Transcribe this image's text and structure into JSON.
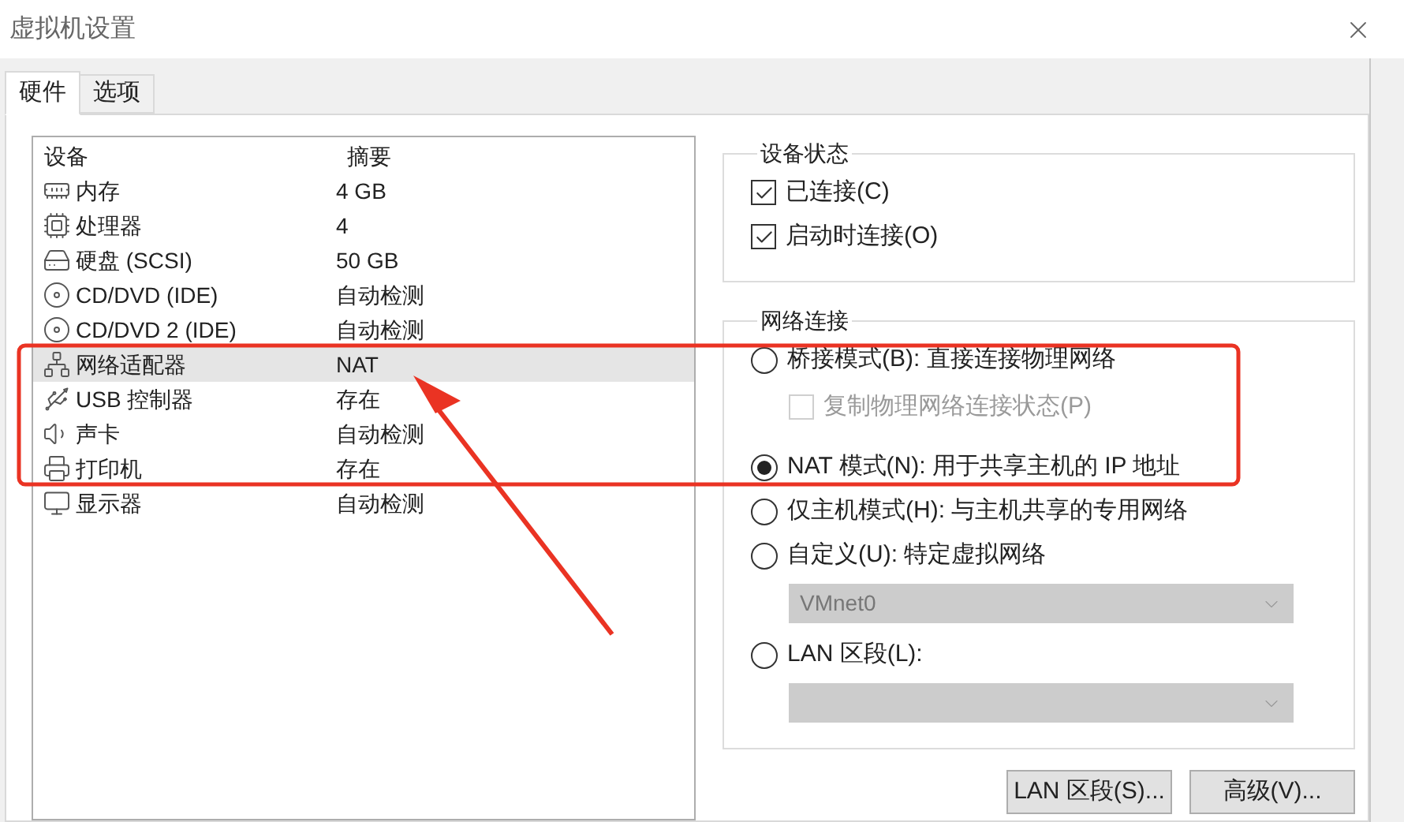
{
  "window": {
    "title": "虚拟机设置"
  },
  "tabs": [
    {
      "label": "硬件",
      "selected": true
    },
    {
      "label": "选项",
      "selected": false
    }
  ],
  "device_table": {
    "columns": [
      "设备",
      "摘要"
    ],
    "rows": [
      {
        "kind": "memory",
        "device": "内存",
        "summary": "4 GB",
        "selected": false
      },
      {
        "kind": "cpu",
        "device": "处理器",
        "summary": "4",
        "selected": false
      },
      {
        "kind": "disk",
        "device": "硬盘 (SCSI)",
        "summary": "50 GB",
        "selected": false
      },
      {
        "kind": "cd",
        "device": "CD/DVD (IDE)",
        "summary": "自动检测",
        "selected": false
      },
      {
        "kind": "cd",
        "device": "CD/DVD 2 (IDE)",
        "summary": "自动检测",
        "selected": false
      },
      {
        "kind": "network",
        "device": "网络适配器",
        "summary": "NAT",
        "selected": true
      },
      {
        "kind": "usb",
        "device": "USB 控制器",
        "summary": "存在",
        "selected": false
      },
      {
        "kind": "sound",
        "device": "声卡",
        "summary": "自动检测",
        "selected": false
      },
      {
        "kind": "printer",
        "device": "打印机",
        "summary": "存在",
        "selected": false
      },
      {
        "kind": "display",
        "device": "显示器",
        "summary": "自动检测",
        "selected": false
      }
    ]
  },
  "device_status": {
    "title": "设备状态",
    "options": [
      {
        "label": "已连接(C)",
        "checked": true
      },
      {
        "label": "启动时连接(O)",
        "checked": true
      }
    ]
  },
  "network": {
    "title": "网络连接",
    "options": [
      {
        "kind": "radio",
        "label": "桥接模式(B): 直接连接物理网络",
        "selected": false
      },
      {
        "kind": "checkbox",
        "label": "复制物理网络连接状态(P)",
        "checked": false,
        "disabled": true
      },
      {
        "kind": "radio",
        "label": "NAT 模式(N): 用于共享主机的 IP 地址",
        "selected": true
      },
      {
        "kind": "radio",
        "label": "仅主机模式(H): 与主机共享的专用网络",
        "selected": false
      },
      {
        "kind": "radio",
        "label": "自定义(U): 特定虚拟网络",
        "selected": false
      },
      {
        "kind": "dropdown",
        "value": "VMnet0",
        "disabled": true
      },
      {
        "kind": "radio",
        "label": "LAN 区段(L):",
        "selected": false
      },
      {
        "kind": "dropdown",
        "disabled": true
      }
    ]
  },
  "buttons": [
    "LAN 区段(S)...",
    "高级(V)..."
  ]
}
